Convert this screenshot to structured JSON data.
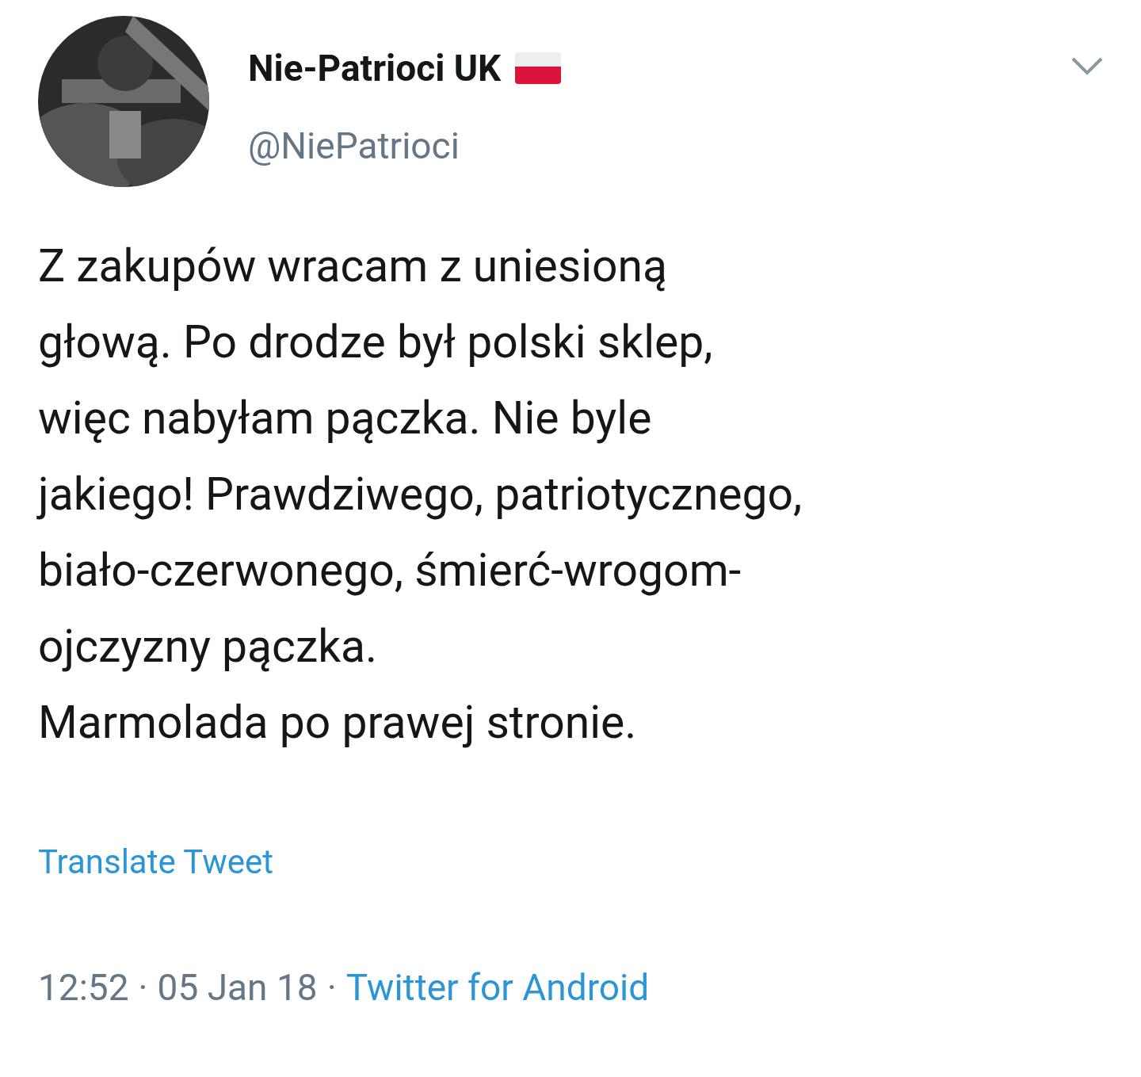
{
  "author": {
    "name": "Nie-Patrioci UK",
    "handle": "@NiePatrioci"
  },
  "tweet": {
    "text": "Z zakupów wracam z uniesioną\ngłową. Po drodze był polski sklep,\nwięc nabyłam pączka. Nie byle\njakiego! Prawdziwego, patriotycznego,\nbiało-czerwonego, śmierć-wrogom-\nojczyzny pączka.\nMarmolada po prawej stronie."
  },
  "translate_link": "Translate Tweet",
  "footer": {
    "time": "12:52",
    "separator_1": "·",
    "date": "05 Jan 18",
    "separator_2": "·",
    "source": "Twitter for Android"
  }
}
